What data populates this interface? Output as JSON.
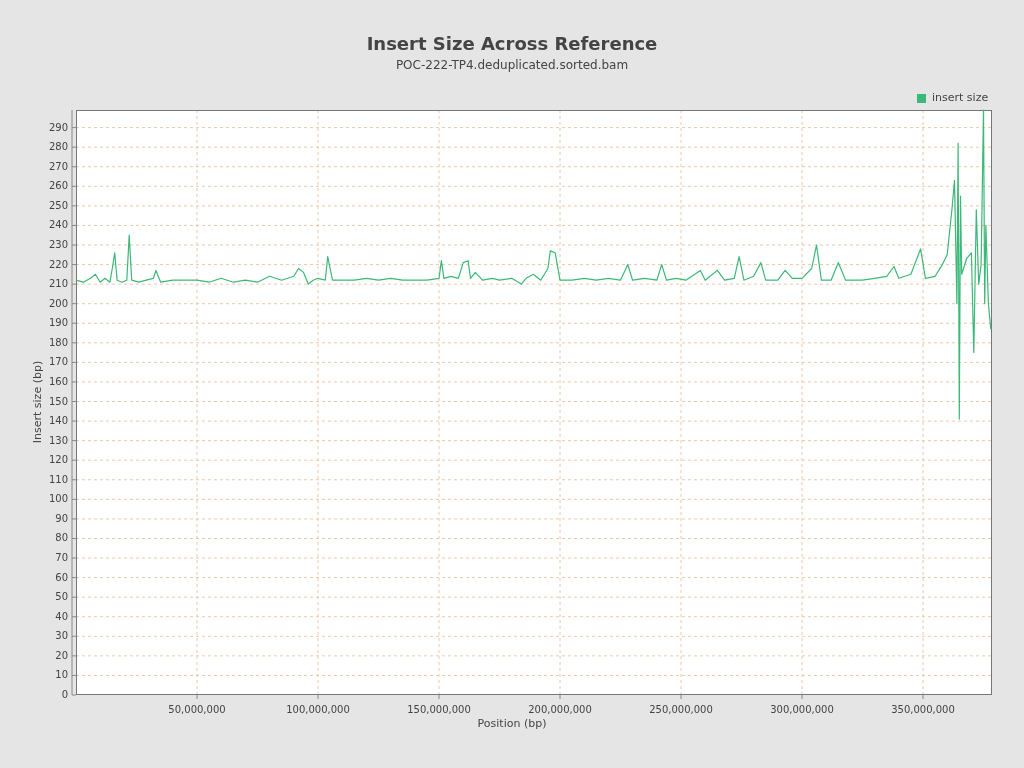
{
  "chart_data": {
    "type": "line",
    "grid": true,
    "title": "Insert Size Across Reference",
    "subtitle": "POC-222-TP4.deduplicated.sorted.bam",
    "xlabel": "Position (bp)",
    "ylabel": "Insert size (bp)",
    "xlim": [
      0,
      378500000
    ],
    "ylim": [
      0,
      299
    ],
    "xticks": [
      {
        "value": 50000000,
        "label": "50,000,000"
      },
      {
        "value": 100000000,
        "label": "100,000,000"
      },
      {
        "value": 150000000,
        "label": "150,000,000"
      },
      {
        "value": 200000000,
        "label": "200,000,000"
      },
      {
        "value": 250000000,
        "label": "250,000,000"
      },
      {
        "value": 300000000,
        "label": "300,000,000"
      },
      {
        "value": 350000000,
        "label": "350,000,000"
      }
    ],
    "yticks": [
      0,
      10,
      20,
      30,
      40,
      50,
      60,
      70,
      80,
      90,
      100,
      110,
      120,
      130,
      140,
      150,
      160,
      170,
      180,
      190,
      200,
      210,
      220,
      230,
      240,
      250,
      260,
      270,
      280,
      290
    ],
    "x": [
      0,
      3000000,
      6000000,
      8000000,
      10000000,
      12000000,
      14000000,
      15000000,
      16000000,
      17000000,
      19000000,
      21000000,
      22000000,
      23000000,
      26000000,
      29000000,
      32000000,
      33000000,
      35000000,
      40000000,
      45000000,
      50000000,
      55000000,
      60000000,
      65000000,
      70000000,
      75000000,
      80000000,
      85000000,
      90000000,
      92000000,
      94000000,
      96000000,
      98000000,
      100000000,
      103000000,
      104000000,
      106000000,
      110000000,
      115000000,
      120000000,
      125000000,
      130000000,
      135000000,
      140000000,
      145000000,
      150000000,
      151000000,
      152000000,
      155000000,
      158000000,
      160000000,
      162000000,
      163000000,
      165000000,
      168000000,
      172000000,
      175000000,
      180000000,
      184000000,
      186000000,
      189000000,
      192000000,
      195000000,
      196000000,
      198000000,
      200000000,
      205000000,
      210000000,
      215000000,
      220000000,
      225000000,
      228000000,
      230000000,
      235000000,
      240000000,
      242000000,
      244000000,
      248000000,
      252000000,
      258000000,
      260000000,
      265000000,
      268000000,
      272000000,
      274000000,
      276000000,
      280000000,
      283000000,
      285000000,
      290000000,
      293000000,
      296000000,
      300000000,
      304000000,
      306000000,
      308000000,
      312000000,
      315000000,
      318000000,
      325000000,
      330000000,
      335000000,
      338000000,
      340000000,
      345000000,
      349000000,
      351000000,
      355000000,
      358000000,
      360000000,
      362000000,
      363000000,
      364000000,
      364500000,
      365000000,
      365500000,
      366000000,
      368000000,
      370000000,
      371000000,
      372000000,
      373000000,
      374000000,
      375000000,
      375500000,
      376000000,
      377000000,
      378000000
    ],
    "series": [
      {
        "name": "insert size",
        "color": "#3cb878",
        "values": [
          212,
          211,
          213,
          215,
          211,
          213,
          211,
          218,
          226,
          212,
          211,
          212,
          235,
          212,
          211,
          212,
          213,
          217,
          211,
          212,
          212,
          212,
          211,
          213,
          211,
          212,
          211,
          214,
          212,
          214,
          218,
          216,
          210,
          212,
          213,
          212,
          224,
          212,
          212,
          212,
          213,
          212,
          213,
          212,
          212,
          212,
          213,
          222,
          213,
          214,
          213,
          221,
          222,
          213,
          216,
          212,
          213,
          212,
          213,
          210,
          213,
          215,
          212,
          218,
          227,
          226,
          212,
          212,
          213,
          212,
          213,
          212,
          220,
          212,
          213,
          212,
          220,
          212,
          213,
          212,
          217,
          212,
          217,
          212,
          213,
          224,
          212,
          214,
          221,
          212,
          212,
          217,
          213,
          213,
          218,
          230,
          212,
          212,
          221,
          212,
          212,
          213,
          214,
          219,
          213,
          215,
          228,
          213,
          214,
          220,
          225,
          249,
          263,
          200,
          282,
          141,
          255,
          215,
          223,
          226,
          175,
          248,
          210,
          220,
          299,
          200,
          240,
          200,
          187
        ]
      }
    ]
  }
}
